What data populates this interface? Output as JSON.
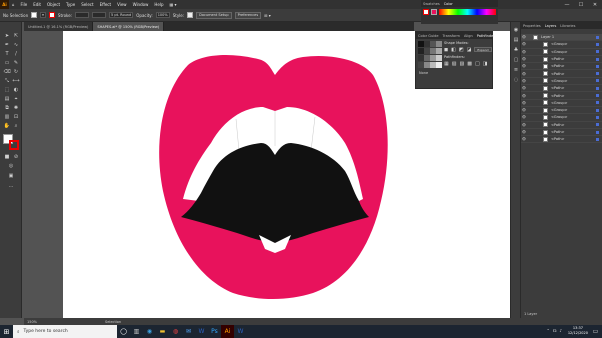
{
  "menubar": {
    "logo": "Ai",
    "items": [
      "File",
      "Edit",
      "Object",
      "Type",
      "Select",
      "Effect",
      "View",
      "Window",
      "Help"
    ],
    "win_controls": [
      "—",
      "☐",
      "✕"
    ]
  },
  "controlbar": {
    "selection_label": "No Selection",
    "stroke_label": "Stroke:",
    "stroke_value": "",
    "brush_value": "5 pt. Round",
    "opacity_label": "Opacity:",
    "opacity_value": "100%",
    "style_label": "Style:",
    "doc_setup": "Document Setup",
    "preferences": "Preferences"
  },
  "tabs": [
    {
      "label": "Untitled-1 @ 16.1% (RGB/Preview)",
      "active": false
    },
    {
      "label": "SHAPES.ai* @ 150% (RGB/Preview)",
      "active": true
    }
  ],
  "color_panel": {
    "tabs": [
      "Swatches",
      "Color"
    ]
  },
  "color_guide": {
    "tabs": [
      "Color Guide",
      "Transform",
      "Align",
      "Pathfinder"
    ],
    "shape_modes_label": "Shape Modes:",
    "pathfinders_label": "Pathfinders:",
    "expand_label": "Expand",
    "none_label": "None"
  },
  "props_panel": {
    "tabs": [
      "Properties",
      "Layers",
      "Libraries"
    ],
    "layers": [
      {
        "name": "Layer 1",
        "top": true
      },
      {
        "name": "<Group>"
      },
      {
        "name": "<Group>"
      },
      {
        "name": "<Path>"
      },
      {
        "name": "<Path>"
      },
      {
        "name": "<Path>"
      },
      {
        "name": "<Group>"
      },
      {
        "name": "<Path>"
      },
      {
        "name": "<Path>"
      },
      {
        "name": "<Group>"
      },
      {
        "name": "<Group>"
      },
      {
        "name": "<Group>"
      },
      {
        "name": "<Path>"
      },
      {
        "name": "<Path>"
      },
      {
        "name": "<Path>"
      }
    ],
    "footer": "1 Layer"
  },
  "status": {
    "zoom": "150%",
    "tool": "Selection"
  },
  "taskbar": {
    "search_placeholder": "Type here to search",
    "time": "13:37",
    "date": "12/12/2020"
  },
  "colors": {
    "lips": "#e8125c",
    "teeth": "#ffffff",
    "mouth": "#111111",
    "chrome": "#535353"
  }
}
